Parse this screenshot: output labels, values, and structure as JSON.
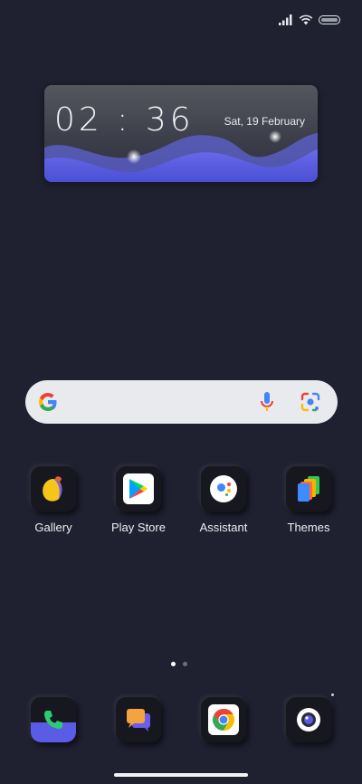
{
  "clock": {
    "time": "02 : 36",
    "date": "Sat, 19 February"
  },
  "apps": [
    {
      "label": "Gallery"
    },
    {
      "label": "Play Store"
    },
    {
      "label": "Assistant"
    },
    {
      "label": "Themes"
    }
  ],
  "dock": [
    {
      "icon": "phone-icon"
    },
    {
      "icon": "messages-icon"
    },
    {
      "icon": "chrome-icon"
    },
    {
      "icon": "camera-icon"
    }
  ],
  "pager": {
    "pages": 2,
    "current": 1
  },
  "colors": {
    "background": "#1f2030",
    "wave": "#5b5ce6",
    "search": "#e9eaee"
  }
}
